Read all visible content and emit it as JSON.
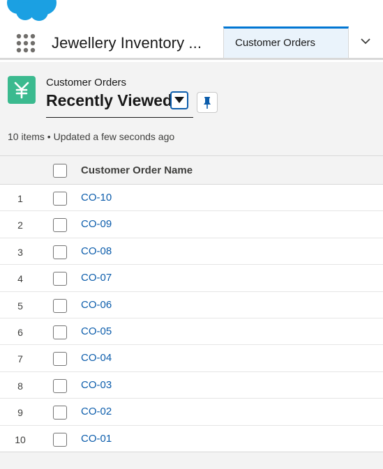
{
  "brand": {
    "logo_icon": "salesforce-cloud-logo",
    "color": "#1ba0e2"
  },
  "nav": {
    "app_name": "Jewellery Inventory ...",
    "active_tab": "Customer Orders",
    "launcher_icon": "app-launcher-grid-icon",
    "more_icon": "chevron-down-icon"
  },
  "header": {
    "object_label": "Customer Orders",
    "object_icon": "currency-yen-icon",
    "object_icon_color": "#3bba8f",
    "list_view_name": "Recently Viewed",
    "dropdown_icon": "caret-down-icon",
    "pin_icon": "pin-icon",
    "meta": "10 items • Updated a few seconds ago"
  },
  "table": {
    "column_header": "Customer Order Name",
    "rows": [
      {
        "num": "1",
        "name": "CO-10"
      },
      {
        "num": "2",
        "name": "CO-09"
      },
      {
        "num": "3",
        "name": "CO-08"
      },
      {
        "num": "4",
        "name": "CO-07"
      },
      {
        "num": "5",
        "name": "CO-06"
      },
      {
        "num": "6",
        "name": "CO-05"
      },
      {
        "num": "7",
        "name": "CO-04"
      },
      {
        "num": "8",
        "name": "CO-03"
      },
      {
        "num": "9",
        "name": "CO-02"
      },
      {
        "num": "10",
        "name": "CO-01"
      }
    ]
  },
  "colors": {
    "accent": "#0176d3",
    "link": "#0b5cab",
    "tab_bg": "#eaf3fb"
  }
}
